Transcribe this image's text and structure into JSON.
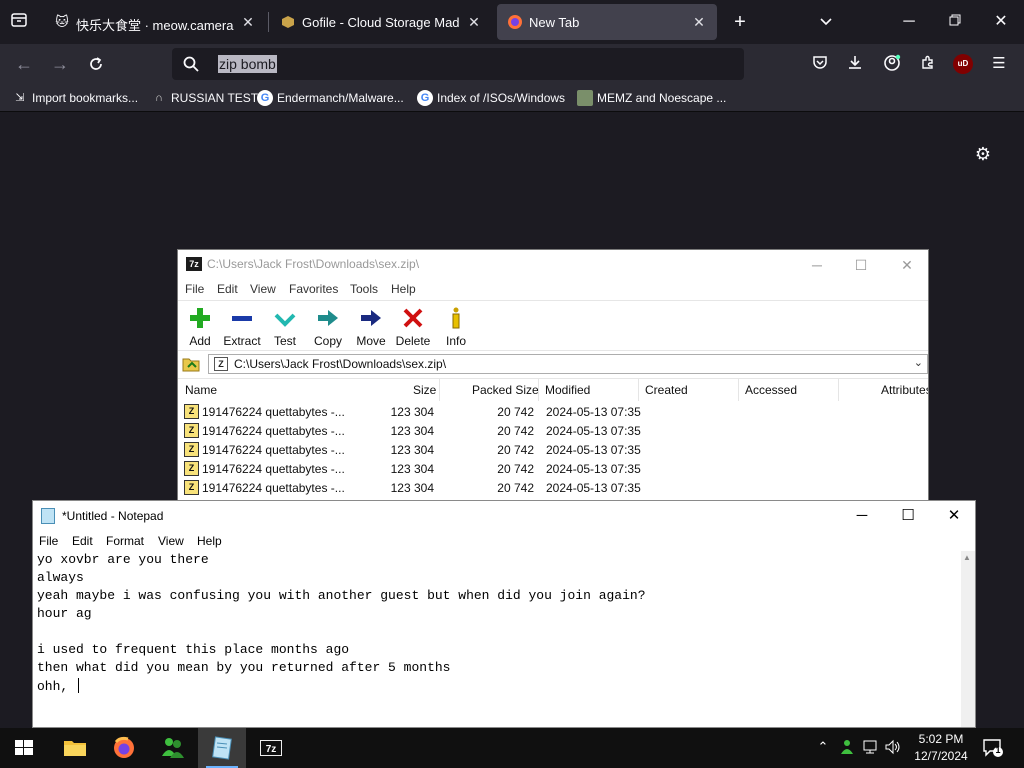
{
  "browser": {
    "tabs": [
      {
        "title": "快乐大食堂 · meow.camera",
        "favicon": "cat-icon",
        "active": false
      },
      {
        "title": "Gofile - Cloud Storage Made Simple",
        "favicon": "gofile-icon",
        "active": false
      },
      {
        "title": "New Tab",
        "favicon": "firefox-icon",
        "active": true
      }
    ],
    "url_text": "zip bomb",
    "bookmarks": [
      {
        "label": "Import bookmarks...",
        "icon": "import-icon"
      },
      {
        "label": "RUSSIAN TEST",
        "icon": "horseshoe-icon"
      },
      {
        "label": "Endermanch/Malware...",
        "icon": "google-icon"
      },
      {
        "label": "Index of /ISOs/Windows",
        "icon": "google-icon"
      },
      {
        "label": "MEMZ and Noescape ...",
        "icon": "image-icon"
      }
    ],
    "ublock_badge": "uD"
  },
  "zip_window": {
    "title": "C:\\Users\\Jack Frost\\Downloads\\sex.zip\\",
    "menu": [
      "File",
      "Edit",
      "View",
      "Favorites",
      "Tools",
      "Help"
    ],
    "toolbar": [
      {
        "label": "Add",
        "icon": "plus-icon"
      },
      {
        "label": "Extract",
        "icon": "minus-icon"
      },
      {
        "label": "Test",
        "icon": "check-icon"
      },
      {
        "label": "Copy",
        "icon": "copy-arrow-icon"
      },
      {
        "label": "Move",
        "icon": "move-arrow-icon"
      },
      {
        "label": "Delete",
        "icon": "delete-x-icon"
      },
      {
        "label": "Info",
        "icon": "info-icon"
      }
    ],
    "path": "C:\\Users\\Jack Frost\\Downloads\\sex.zip\\",
    "columns": [
      "Name",
      "Size",
      "Packed Size",
      "Modified",
      "Created",
      "Accessed",
      "Attributes"
    ],
    "rows": [
      {
        "name": "191476224 quettabytes -...",
        "size": "123 304",
        "packed": "20 742",
        "modified": "2024-05-13 07:35"
      },
      {
        "name": "191476224 quettabytes -...",
        "size": "123 304",
        "packed": "20 742",
        "modified": "2024-05-13 07:35"
      },
      {
        "name": "191476224 quettabytes -...",
        "size": "123 304",
        "packed": "20 742",
        "modified": "2024-05-13 07:35"
      },
      {
        "name": "191476224 quettabytes -...",
        "size": "123 304",
        "packed": "20 742",
        "modified": "2024-05-13 07:35"
      },
      {
        "name": "191476224 quettabytes -...",
        "size": "123 304",
        "packed": "20 742",
        "modified": "2024-05-13 07:35"
      }
    ]
  },
  "notepad": {
    "title": "*Untitled - Notepad",
    "menu": [
      "File",
      "Edit",
      "Format",
      "View",
      "Help"
    ],
    "lines": [
      "yo xovbr are you there",
      "always",
      "yeah maybe i was confusing you with another guest but when did you join again?",
      "hour ag",
      "",
      "i used to frequent this place months ago",
      "then what did you mean by you returned after 5 months",
      "ohh, "
    ]
  },
  "taskbar": {
    "apps": [
      {
        "name": "file-explorer",
        "icon": "folder-icon"
      },
      {
        "name": "firefox",
        "icon": "firefox-icon"
      },
      {
        "name": "people-app",
        "icon": "people-icon"
      },
      {
        "name": "notepad",
        "icon": "notepad-icon",
        "active": true
      },
      {
        "name": "7-zip",
        "icon": "7zip-icon"
      }
    ],
    "time": "5:02 PM",
    "date": "12/7/2024",
    "notification_count": "1"
  },
  "colors": {
    "firefox_bg": "#1c1b22",
    "firefox_toolbar": "#2b2a33",
    "active_tab": "#42414d",
    "taskbar": "#101010",
    "accent": "#6bb3ff"
  }
}
